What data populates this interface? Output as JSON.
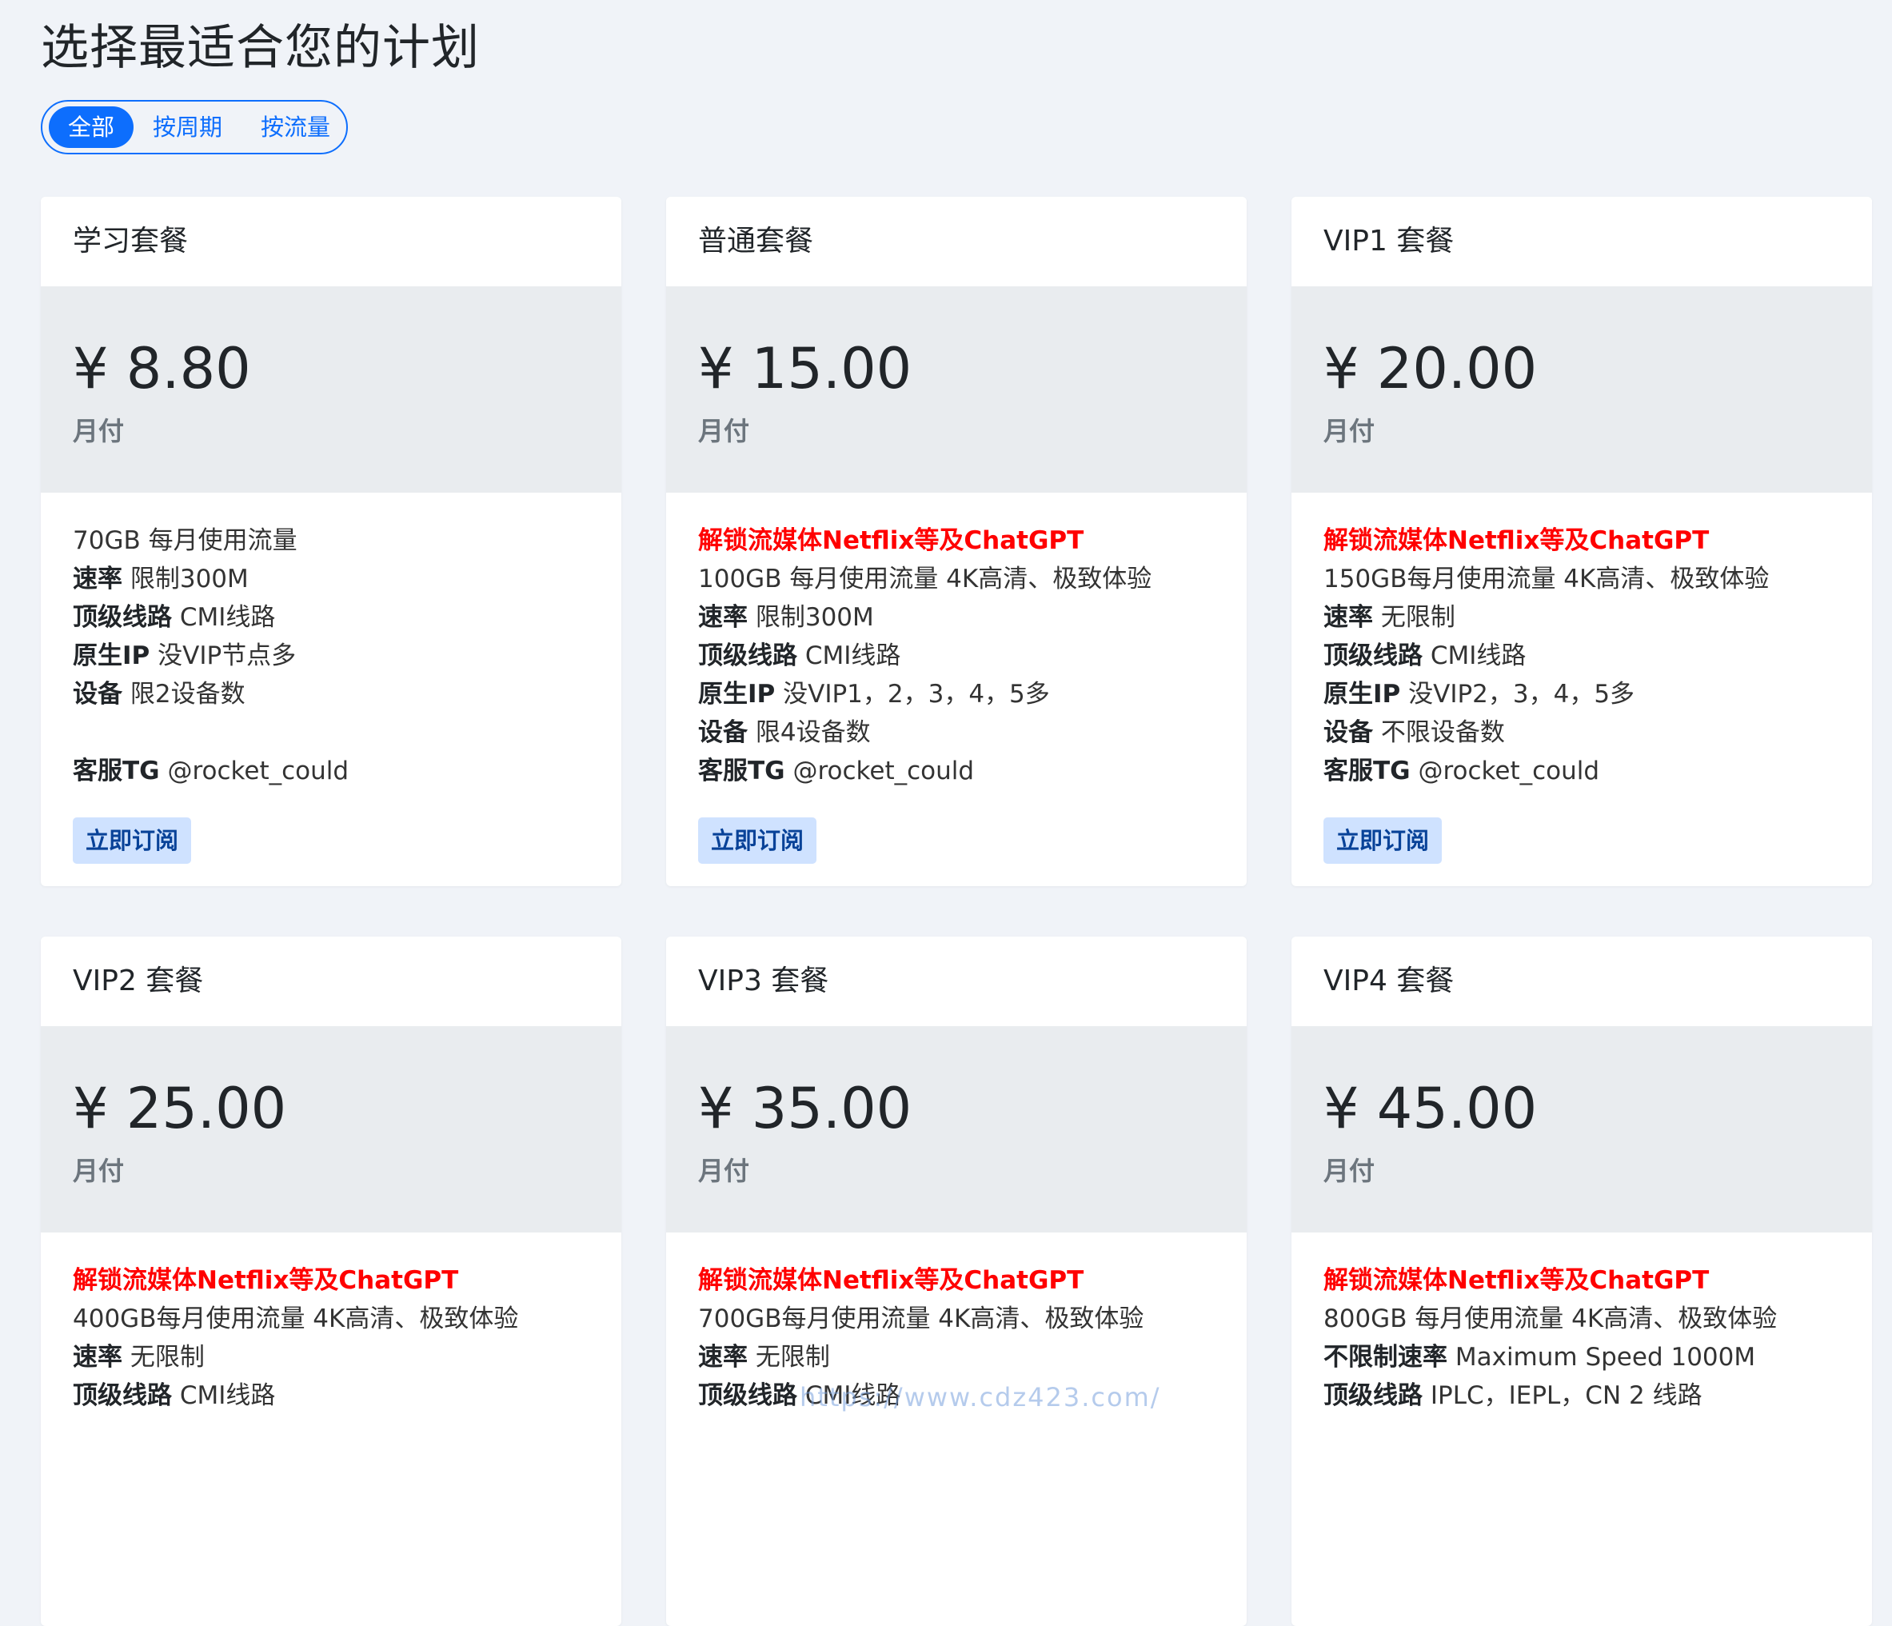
{
  "page": {
    "title": "选择最适合您的计划",
    "watermark": "https://www.cdz423.com/"
  },
  "filters": [
    {
      "label": "全部",
      "active": true
    },
    {
      "label": "按周期",
      "active": false
    },
    {
      "label": "按流量",
      "active": false
    }
  ],
  "colors": {
    "accent": "#0d6efd",
    "highlight_red": "#ff0000",
    "price_bg": "#e9ecef",
    "button_bg": "#cfe2ff",
    "button_text": "#084298"
  },
  "plans": [
    {
      "name": "学习套餐",
      "price": "¥ 8.80",
      "period": "月付",
      "features": [
        {
          "text": "70GB 每月使用流量"
        },
        {
          "label": "速率",
          "text": " 限制300M"
        },
        {
          "label": "顶级线路",
          "text": " CMI线路"
        },
        {
          "label": "原生IP",
          "text": " 没VIP节点多"
        },
        {
          "label": "设备",
          "text": " 限2设备数"
        },
        {
          "text": ""
        },
        {
          "label": "客服TG",
          "text": " @rocket_could"
        }
      ],
      "button": "立即订阅"
    },
    {
      "name": "普通套餐",
      "price": "¥ 15.00",
      "period": "月付",
      "features": [
        {
          "text": "解锁流媒体Netflix等及ChatGPT",
          "red": true
        },
        {
          "text": "100GB 每月使用流量 4K高清、极致体验"
        },
        {
          "label": "速率",
          "text": " 限制300M"
        },
        {
          "label": "顶级线路",
          "text": " CMI线路"
        },
        {
          "label": "原生IP",
          "text": " 没VIP1，2，3，4，5多"
        },
        {
          "label": "设备",
          "text": " 限4设备数"
        },
        {
          "label": "客服TG",
          "text": " @rocket_could"
        }
      ],
      "button": "立即订阅"
    },
    {
      "name": "VIP1 套餐",
      "price": "¥ 20.00",
      "period": "月付",
      "features": [
        {
          "text": "解锁流媒体Netflix等及ChatGPT",
          "red": true
        },
        {
          "text": "150GB每月使用流量 4K高清、极致体验"
        },
        {
          "label": "速率",
          "text": " 无限制"
        },
        {
          "label": "顶级线路",
          "text": " CMI线路"
        },
        {
          "label": "原生IP",
          "text": " 没VIP2，3，4，5多"
        },
        {
          "label": "设备",
          "text": " 不限设备数"
        },
        {
          "label": "客服TG",
          "text": " @rocket_could"
        }
      ],
      "button": "立即订阅"
    },
    {
      "name": "VIP2 套餐",
      "price": "¥ 25.00",
      "period": "月付",
      "features": [
        {
          "text": "解锁流媒体Netflix等及ChatGPT",
          "red": true
        },
        {
          "text": "400GB每月使用流量 4K高清、极致体验"
        },
        {
          "label": "速率",
          "text": " 无限制"
        },
        {
          "label": "顶级线路",
          "text": " CMI线路"
        }
      ],
      "button": ""
    },
    {
      "name": "VIP3 套餐",
      "price": "¥ 35.00",
      "period": "月付",
      "features": [
        {
          "text": "解锁流媒体Netflix等及ChatGPT",
          "red": true
        },
        {
          "text": "700GB每月使用流量 4K高清、极致体验"
        },
        {
          "label": "速率",
          "text": " 无限制"
        },
        {
          "label": "顶级线路",
          "text": " CMI线路"
        }
      ],
      "button": ""
    },
    {
      "name": "VIP4 套餐",
      "price": "¥ 45.00",
      "period": "月付",
      "features": [
        {
          "text": "解锁流媒体Netflix等及ChatGPT",
          "red": true
        },
        {
          "text": "800GB 每月使用流量 4K高清、极致体验"
        },
        {
          "label": "不限制速率",
          "text": " Maximum Speed 1000M"
        },
        {
          "label": "顶级线路",
          "text": " IPLC，IEPL，CN 2 线路"
        }
      ],
      "button": ""
    }
  ]
}
